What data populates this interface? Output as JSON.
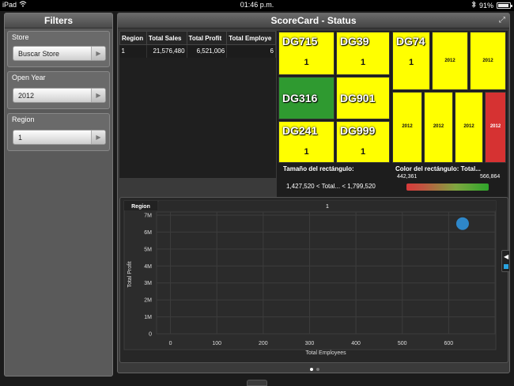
{
  "status_bar": {
    "device": "iPad",
    "time": "01:46 p.m.",
    "battery": "91%"
  },
  "filters": {
    "title": "Filters",
    "groups": [
      {
        "label": "Store",
        "value": "Buscar Store"
      },
      {
        "label": "Open Year",
        "value": "2012"
      },
      {
        "label": "Region",
        "value": "1"
      }
    ]
  },
  "scorecard": {
    "title": "ScoreCard - Status",
    "table": {
      "headers": [
        "Region",
        "Total Sales",
        "Total Profit",
        "Total Employe"
      ],
      "row": [
        "1",
        "21,576,480",
        "6,521,006",
        "6"
      ]
    },
    "treemap": {
      "tiles": [
        {
          "label": "DG715",
          "value": "1",
          "color": "#ffff00"
        },
        {
          "label": "DG39",
          "value": "1",
          "color": "#ffff00"
        },
        {
          "label": "DG316",
          "value": "",
          "color": "#2f9a30"
        },
        {
          "label": "DG901",
          "value": "",
          "color": "#ffff00"
        },
        {
          "label": "DG241",
          "value": "1",
          "color": "#ffff00"
        },
        {
          "label": "DG999",
          "value": "1",
          "color": "#ffff00"
        },
        {
          "label": "DG74",
          "value": "1",
          "color": "#ffff00"
        },
        {
          "label": "",
          "value": "2012",
          "color": "#ffff00"
        },
        {
          "label": "",
          "value": "2012",
          "color": "#ffff00"
        },
        {
          "label": "",
          "value": "2012",
          "color": "#ffff00"
        },
        {
          "label": "",
          "value": "2012",
          "color": "#ffff00"
        },
        {
          "label": "",
          "value": "2012",
          "color": "#ffff00"
        },
        {
          "label": "",
          "value": "2012",
          "color": "#d63232"
        }
      ],
      "size_legend_title": "Tamaño del rectángulo:",
      "size_legend_range": "1,427,520 < Total... < 1,799,520",
      "color_legend_title": "Color del rectángulo: Total...",
      "color_min": "442,361",
      "color_max": "566,864"
    },
    "chart_data": {
      "type": "scatter",
      "panel_header_label": "Region",
      "panel_header_value": "1",
      "xlabel": "Total Employees",
      "ylabel": "Total Profit",
      "x_ticks": [
        "0",
        "100",
        "200",
        "300",
        "400",
        "500",
        "600"
      ],
      "y_ticks": [
        "0",
        "1M",
        "2M",
        "3M",
        "4M",
        "5M",
        "6M",
        "7M"
      ],
      "xlim": [
        -30,
        700
      ],
      "ylim": [
        0,
        7000000
      ],
      "points": [
        {
          "x": 630,
          "y": 6500000
        }
      ],
      "point_color": "#2e87c9"
    }
  }
}
